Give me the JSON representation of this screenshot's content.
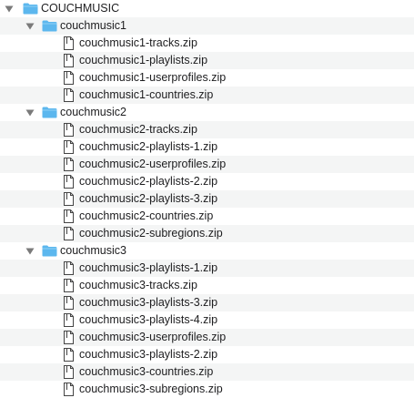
{
  "root": {
    "label": "COUCHMUSIC",
    "expanded": true,
    "folders": [
      {
        "label": "couchmusic1",
        "expanded": true,
        "files": [
          "couchmusic1-tracks.zip",
          "couchmusic1-playlists.zip",
          "couchmusic1-userprofiles.zip",
          "couchmusic1-countries.zip"
        ]
      },
      {
        "label": "couchmusic2",
        "expanded": true,
        "files": [
          "couchmusic2-tracks.zip",
          "couchmusic2-playlists-1.zip",
          "couchmusic2-userprofiles.zip",
          "couchmusic2-playlists-2.zip",
          "couchmusic2-playlists-3.zip",
          "couchmusic2-countries.zip",
          "couchmusic2-subregions.zip"
        ]
      },
      {
        "label": "couchmusic3",
        "expanded": true,
        "files": [
          "couchmusic3-playlists-1.zip",
          "couchmusic3-tracks.zip",
          "couchmusic3-playlists-3.zip",
          "couchmusic3-playlists-4.zip",
          "couchmusic3-userprofiles.zip",
          "couchmusic3-playlists-2.zip",
          "couchmusic3-countries.zip",
          "couchmusic3-subregions.zip"
        ]
      }
    ]
  },
  "icons": {
    "folder": "folder-icon",
    "file": "document-icon",
    "toggle": "disclosure-triangle-icon"
  },
  "colors": {
    "folder": "#5cb7ee",
    "stripe": "#f4f5f5"
  }
}
